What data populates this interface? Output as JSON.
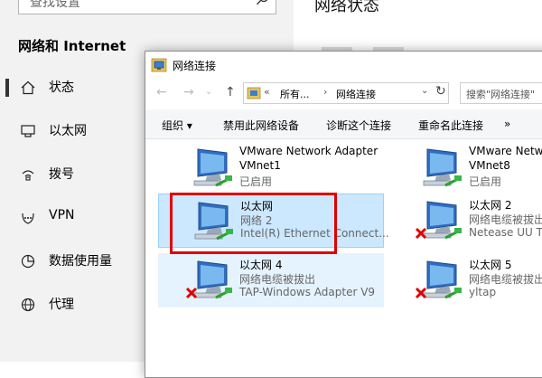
{
  "settings": {
    "search_placeholder": "查找设置",
    "heading": "网络和 Internet",
    "nav": [
      {
        "label": "状态",
        "icon": "home-icon"
      },
      {
        "label": "以太网",
        "icon": "ethernet-icon"
      },
      {
        "label": "拨号",
        "icon": "dialup-icon"
      },
      {
        "label": "VPN",
        "icon": "vpn-icon"
      },
      {
        "label": "数据使用量",
        "icon": "data-usage-icon"
      },
      {
        "label": "代理",
        "icon": "globe-icon"
      }
    ],
    "right_title": "网络状态"
  },
  "window": {
    "title": "网络连接",
    "address": {
      "chevrons": "«",
      "segment1": "所有...",
      "separator": "›",
      "segment2": "网络连接",
      "dropdown": "⌄",
      "refresh": "↻"
    },
    "search_placeholder": "搜索\"网络连接\"",
    "nav_buttons": {
      "back": "←",
      "forward": "→",
      "dropdown": "⌄",
      "up": "↑"
    },
    "toolbar": {
      "organize": "组织 ▾",
      "disable": "禁用此网络设备",
      "diagnose": "诊断这个连接",
      "rename": "重命名此连接",
      "more": "»"
    },
    "connections": [
      {
        "name": "VMware Network Adapter",
        "line2": "VMnet1",
        "line3": "已启用",
        "disconnected": false
      },
      {
        "name": "VMware Netw",
        "line2": "VMnet8",
        "line3": "已启用",
        "disconnected": false
      },
      {
        "name": "以太网",
        "line2": "网络 2",
        "line3": "Intel(R) Ethernet Connect...",
        "disconnected": false
      },
      {
        "name": "以太网 2",
        "line2": "网络电缆被拔出",
        "line3": "Netease UU T",
        "disconnected": true
      },
      {
        "name": "以太网 4",
        "line2": "网络电缆被拔出",
        "line3": "TAP-Windows Adapter V9",
        "disconnected": true
      },
      {
        "name": "以太网 5",
        "line2": "网络电缆被拔出",
        "line3": "yltap",
        "disconnected": true
      }
    ]
  },
  "colors": {
    "highlight": "#e00000",
    "selection": "#cce8ff",
    "accent": "#0078d7"
  }
}
